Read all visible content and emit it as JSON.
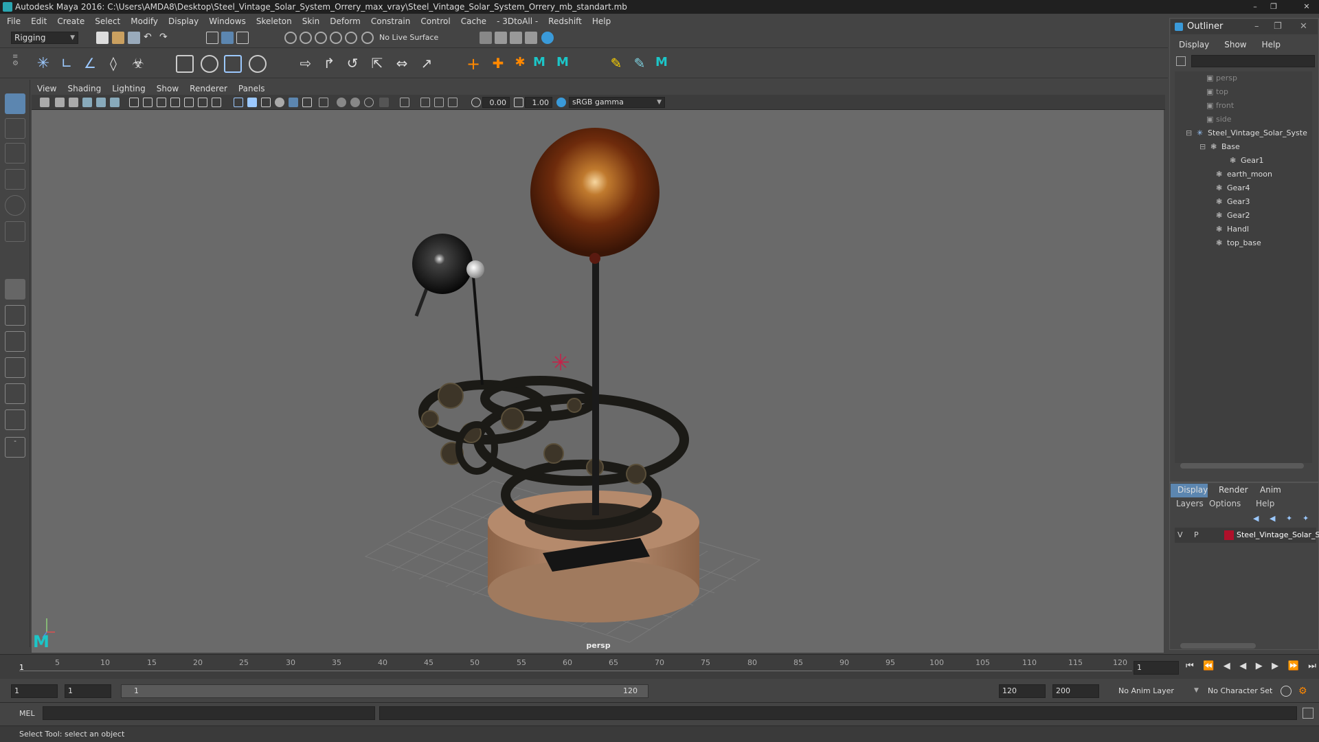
{
  "window": {
    "title": "Autodesk Maya 2016: C:\\Users\\AMDA8\\Desktop\\Steel_Vintage_Solar_System_Orrery_max_vray\\Steel_Vintage_Solar_System_Orrery_mb_standart.mb"
  },
  "menu": [
    "File",
    "Edit",
    "Create",
    "Select",
    "Modify",
    "Display",
    "Windows",
    "Skeleton",
    "Skin",
    "Deform",
    "Constrain",
    "Control",
    "Cache",
    "- 3DtoAll -",
    "Redshift",
    "Help"
  ],
  "status_line": {
    "mode": "Rigging",
    "live_surface": "No Live Surface"
  },
  "panel_menu": [
    "View",
    "Shading",
    "Lighting",
    "Show",
    "Renderer",
    "Panels"
  ],
  "panel_toolbar": {
    "exposure": "0.00",
    "gamma": "1.00",
    "color_space": "sRGB gamma"
  },
  "viewport": {
    "camera_label": "persp"
  },
  "outliner": {
    "title": "Outliner",
    "menu": [
      "Display",
      "Show",
      "Help"
    ],
    "items": [
      {
        "label": "persp",
        "kind": "camera"
      },
      {
        "label": "top",
        "kind": "camera"
      },
      {
        "label": "front",
        "kind": "camera"
      },
      {
        "label": "side",
        "kind": "camera"
      },
      {
        "label": "Steel_Vintage_Solar_Syste",
        "kind": "group"
      },
      {
        "label": "Base",
        "kind": "transform"
      },
      {
        "label": "Gear1",
        "kind": "transform"
      },
      {
        "label": "earth_moon",
        "kind": "transform"
      },
      {
        "label": "Gear4",
        "kind": "transform"
      },
      {
        "label": "Gear3",
        "kind": "transform"
      },
      {
        "label": "Gear2",
        "kind": "transform"
      },
      {
        "label": "Handl",
        "kind": "transform"
      },
      {
        "label": "top_base",
        "kind": "transform"
      }
    ]
  },
  "layer_editor": {
    "tabs": [
      "Display",
      "Render",
      "Anim"
    ],
    "menu": [
      "Layers",
      "Options",
      "Help"
    ],
    "layer": {
      "v": "V",
      "p": "P",
      "name": "Steel_Vintage_Solar_Sy",
      "color": "#b0102a"
    }
  },
  "timeline": {
    "ticks": [
      "5",
      "10",
      "15",
      "20",
      "25",
      "30",
      "35",
      "40",
      "45",
      "50",
      "55",
      "60",
      "65",
      "70",
      "75",
      "80",
      "85",
      "90",
      "95",
      "100",
      "105",
      "110",
      "115",
      "120"
    ],
    "start_marker": "1",
    "current_frame": "1"
  },
  "range": {
    "start": "1",
    "playback_start": "1",
    "slider_start": "1",
    "slider_end": "120",
    "playback_end": "120",
    "end": "200",
    "anim_layer": "No Anim Layer",
    "char_set": "No Character Set"
  },
  "command_line": {
    "label": "MEL"
  },
  "help_line": {
    "text": "Select Tool: select an object"
  }
}
